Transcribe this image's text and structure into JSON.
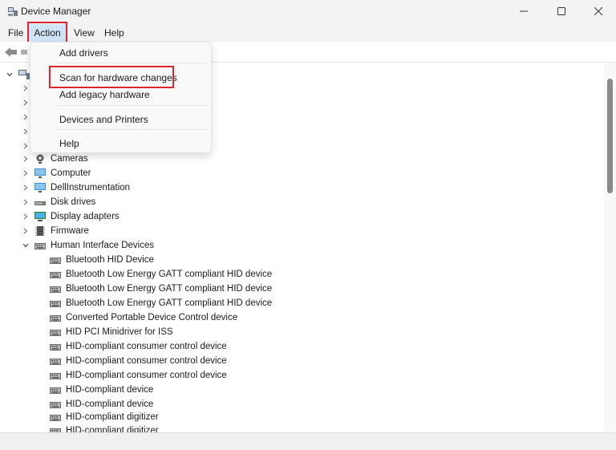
{
  "window": {
    "title": "Device Manager"
  },
  "menubar": {
    "file": "File",
    "action": "Action",
    "view": "View",
    "help": "Help"
  },
  "dropdown": {
    "items": [
      "Add drivers",
      "Scan for hardware changes",
      "Add legacy hardware",
      "Devices and Printers",
      "Help"
    ]
  },
  "tree": {
    "categories": [
      "Cameras",
      "Computer",
      "DellInstrumentation",
      "Disk drives",
      "Display adapters",
      "Firmware",
      "Human Interface Devices"
    ],
    "hid_children": [
      "Bluetooth HID Device",
      "Bluetooth Low Energy GATT compliant HID device",
      "Bluetooth Low Energy GATT compliant HID device",
      "Bluetooth Low Energy GATT compliant HID device",
      "Converted Portable Device Control device",
      "HID PCI Minidriver for ISS",
      "HID-compliant consumer control device",
      "HID-compliant consumer control device",
      "HID-compliant consumer control device",
      "HID-compliant device",
      "HID-compliant device",
      "HID-compliant digitizer",
      "HID-compliant digitizer"
    ]
  },
  "colors": {
    "highlight": "#e0262d",
    "menu_active": "#cfe4f7"
  },
  "icons": {
    "app": "device-manager-icon",
    "back": "arrow-left-icon",
    "forward": "arrow-right-icon",
    "camera": "camera-icon",
    "computer": "monitor-icon",
    "hid": "keyboard-icon"
  }
}
